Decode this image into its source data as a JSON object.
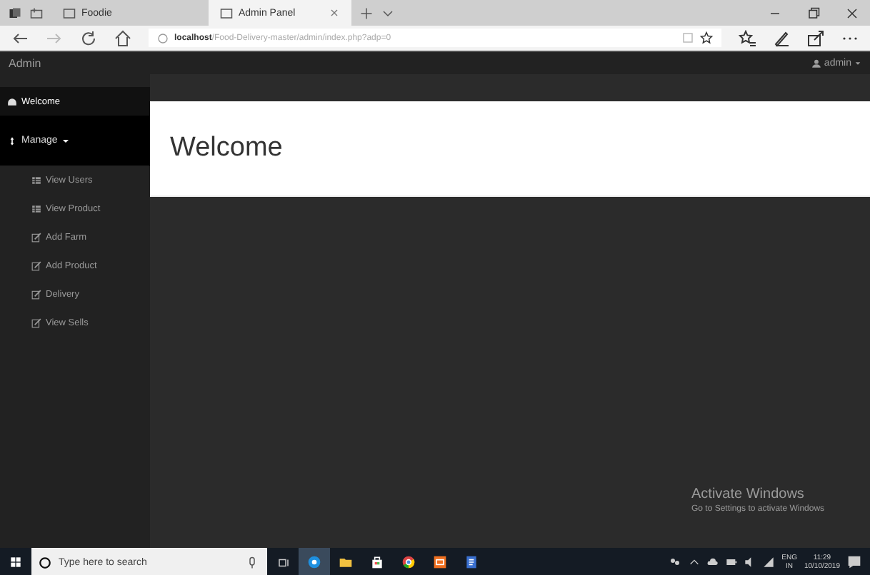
{
  "browser": {
    "tabs": [
      {
        "label": "Foodie",
        "selected": false
      },
      {
        "label": "Admin Panel",
        "selected": true
      }
    ],
    "url_host": "localhost",
    "url_path": "/Food-Delivery-master/admin/index.php?adp=0"
  },
  "navbar": {
    "brand": "Admin",
    "user": "admin"
  },
  "sidebar": {
    "items": [
      {
        "label": "Welcome",
        "kind": "home",
        "selected": true
      },
      {
        "label": "Manage",
        "kind": "menu",
        "expanded": true,
        "children": [
          {
            "label": "View Users",
            "kind": "table"
          },
          {
            "label": "View Product",
            "kind": "table"
          },
          {
            "label": "Add Farm",
            "kind": "edit"
          },
          {
            "label": "Add Product",
            "kind": "edit"
          },
          {
            "label": "Delivery",
            "kind": "edit"
          },
          {
            "label": "View Sells",
            "kind": "edit"
          }
        ]
      }
    ]
  },
  "main": {
    "heading": "Welcome"
  },
  "activation": {
    "title": "Activate Windows",
    "subtitle": "Go to Settings to activate Windows"
  },
  "taskbar": {
    "search_placeholder": "Type here to search",
    "language": "ENG",
    "region": "IN",
    "time": "11:29",
    "date": "10/10/2019"
  }
}
